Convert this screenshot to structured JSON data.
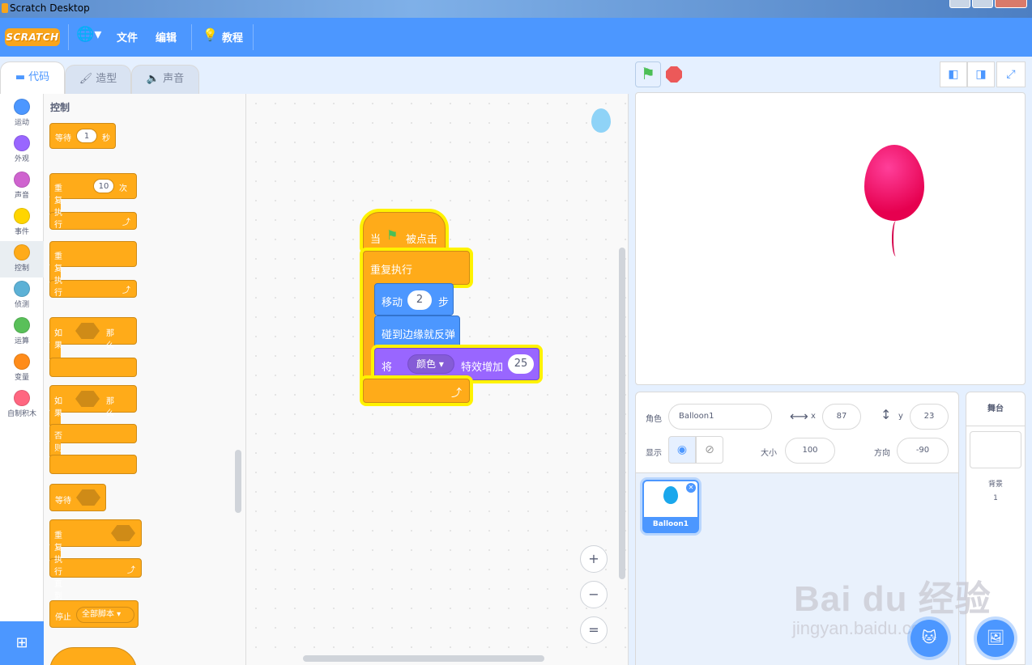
{
  "window": {
    "title": "Scratch Desktop"
  },
  "menubar": {
    "logo": "SCRATCH",
    "file": "文件",
    "edit": "编辑",
    "tutorials": "教程"
  },
  "tabs": [
    {
      "label": "代码"
    },
    {
      "label": "造型"
    },
    {
      "label": "声音"
    }
  ],
  "categories": [
    {
      "label": "运动",
      "color": "#4c97ff"
    },
    {
      "label": "外观",
      "color": "#9966ff"
    },
    {
      "label": "声音",
      "color": "#cf63cf"
    },
    {
      "label": "事件",
      "color": "#ffd500"
    },
    {
      "label": "控制",
      "color": "#ffab19"
    },
    {
      "label": "侦测",
      "color": "#5cb1d6"
    },
    {
      "label": "运算",
      "color": "#59c059"
    },
    {
      "label": "变量",
      "color": "#ff8c1a"
    },
    {
      "label": "自制积木",
      "color": "#ff6680"
    }
  ],
  "palette": {
    "title": "控制",
    "wait": {
      "label": "等待",
      "value": "1",
      "unit": "秒"
    },
    "repeat": {
      "label": "重复执行",
      "value": "10",
      "unit": "次"
    },
    "forever": {
      "label": "重复执行"
    },
    "if_then": {
      "if": "如果",
      "then": "那么"
    },
    "if_else": {
      "if": "如果",
      "then": "那么",
      "else": "否则"
    },
    "wait_until": {
      "label": "等待"
    },
    "repeat_until": {
      "label": "重复执行直到"
    },
    "stop": {
      "label": "停止",
      "option": "全部脚本"
    }
  },
  "script": {
    "hat": {
      "when": "当",
      "clicked": "被点击"
    },
    "forever": "重复执行",
    "move": {
      "label": "移动",
      "value": "2",
      "unit": "步"
    },
    "bounce": "碰到边缘就反弹",
    "effect": {
      "set": "将",
      "option": "颜色",
      "change": "特效增加",
      "value": "25"
    }
  },
  "zoom": {
    "in": "+",
    "out": "−",
    "reset": "="
  },
  "sprite_info": {
    "sprite_label": "角色",
    "sprite_name": "Balloon1",
    "x_label": "x",
    "x": "87",
    "y_label": "y",
    "y": "23",
    "show_label": "显示",
    "size_label": "大小",
    "size": "100",
    "direction_label": "方向",
    "direction": "-90"
  },
  "sprites": [
    {
      "name": "Balloon1"
    }
  ],
  "stage_pane": {
    "title": "舞台",
    "backdrop_label": "背景",
    "backdrop_count": "1"
  },
  "watermark": {
    "brand": "Bai du 经验",
    "url": "jingyan.baidu.com"
  }
}
